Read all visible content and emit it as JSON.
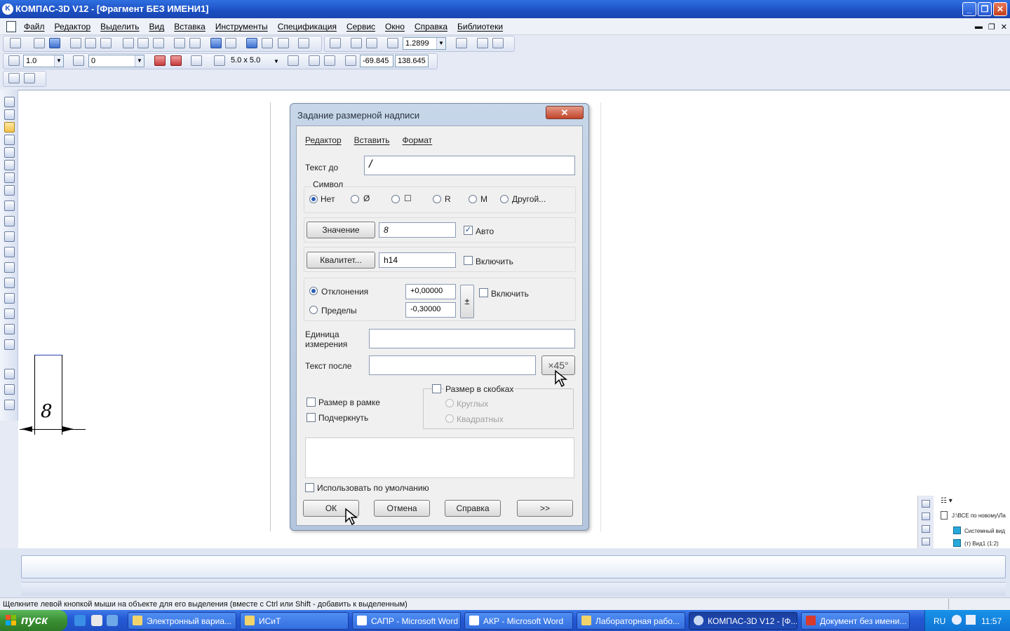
{
  "window": {
    "title": "КОМПАС-3D V12 - [Фрагмент БЕЗ ИМЕНИ1]",
    "icon": "kompas-icon"
  },
  "menu": [
    "Файл",
    "Редактор",
    "Выделить",
    "Вид",
    "Вставка",
    "Инструменты",
    "Спецификация",
    "Сервис",
    "Окно",
    "Справка",
    "Библиотеки"
  ],
  "toolbar": {
    "zoom_value": "1.2899",
    "style_value": "1.0",
    "layer_value": "0",
    "grid_value": "5.0 x 5.0",
    "coord_x": "-69.845",
    "coord_y": "138.645"
  },
  "drawing": {
    "dimension_label": "8"
  },
  "dialog": {
    "title": "Задание размерной надписи",
    "menu": [
      "Редактор",
      "Вставить",
      "Формат"
    ],
    "text_before_label": "Текст до",
    "text_before_value": "/",
    "symbol_label": "Символ",
    "symbols": [
      "Нет",
      "Ø",
      "☐",
      "R",
      "M",
      "Другой..."
    ],
    "value_button": "Значение",
    "value_field": "8",
    "auto_label": "Авто",
    "auto_checked": true,
    "quality_button": "Квалитет...",
    "quality_field": "h14",
    "quality_include": "Включить",
    "deviation_label": "Отклонения",
    "limits_label": "Пределы",
    "dev_upper": "+0,00000",
    "dev_lower": "-0,30000",
    "dev_include": "Включить",
    "plusminus": "±",
    "units_label": "Единица измерения",
    "units_value": "",
    "text_after_label": "Текст после",
    "text_after_value": "",
    "angle_button": "×45°",
    "framed_label": "Размер в рамке",
    "underline_label": "Подчеркнуть",
    "brackets_label": "Размер в скобках",
    "round_label": "Круглых",
    "square_label": "Квадратных",
    "default_label": "Использовать по умолчанию",
    "ok": "ОК",
    "cancel": "Отмена",
    "help": "Справка",
    "more": ">>",
    "close": "✕"
  },
  "tree": {
    "path": "J:\\ВСЕ по новому\\Ла",
    "items": [
      "Системный вид",
      "(т) Вид1 (1:2)"
    ]
  },
  "statusbar": {
    "hint": "Щелкните левой кнопкой мыши на объекте для его выделения (вместе с Ctrl или Shift - добавить к выделенным)"
  },
  "taskbar": {
    "start": "пуск",
    "tasks": [
      {
        "label": "Электронный вариа...",
        "icon": "folder-icon"
      },
      {
        "label": "ИСиТ",
        "icon": "folder-icon"
      },
      {
        "label": "САПР - Microsoft Word",
        "icon": "word-icon"
      },
      {
        "label": "АКР - Microsoft Word",
        "icon": "word-icon"
      },
      {
        "label": "Лабораторная рабо...",
        "icon": "folder-icon"
      },
      {
        "label": "КОМПАС-3D V12 - [Ф...",
        "icon": "kompas-icon"
      },
      {
        "label": "Документ без имени...",
        "icon": "app-icon"
      }
    ],
    "lang": "RU",
    "clock": "11:57"
  }
}
